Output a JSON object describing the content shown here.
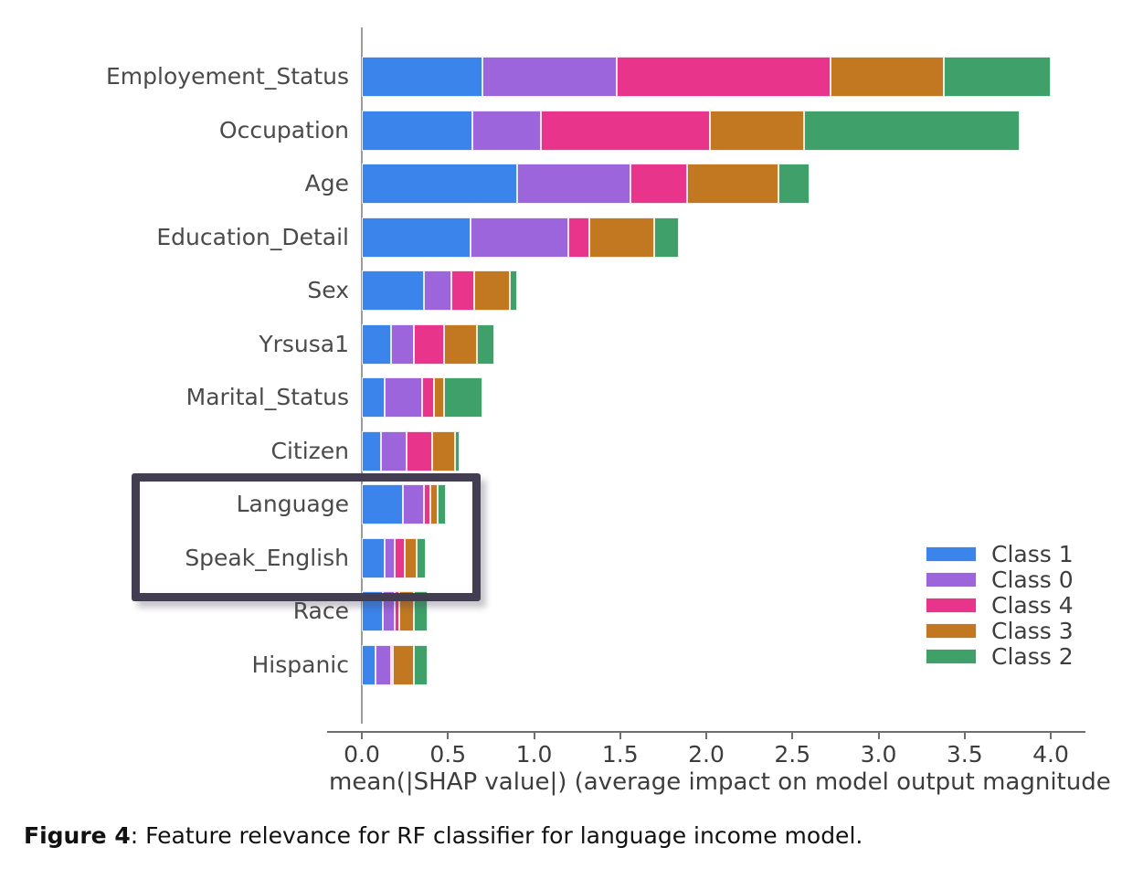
{
  "caption": {
    "label": "Figure 4",
    "text": ": Feature relevance for RF classifier for language income model."
  },
  "chart_data": {
    "type": "bar",
    "orientation": "horizontal",
    "stacked": true,
    "title": "",
    "xlabel": "mean(|SHAP value|) (average impact on model output magnitude",
    "ylabel": "",
    "xlim": [
      0.0,
      4.0
    ],
    "xticks": [
      "0.0",
      "0.5",
      "1.0",
      "1.5",
      "2.0",
      "2.5",
      "3.0",
      "3.5",
      "4.0"
    ],
    "xtick_values": [
      0.0,
      0.5,
      1.0,
      1.5,
      2.0,
      2.5,
      3.0,
      3.5,
      4.0
    ],
    "grid": false,
    "legend_position": "center right",
    "categories": [
      "Employement_Status",
      "Occupation",
      "Age",
      "Education_Detail",
      "Sex",
      "Yrsusa1",
      "Marital_Status",
      "Citizen",
      "Language",
      "Speak_English",
      "Race",
      "Hispanic"
    ],
    "series": [
      {
        "name": "Class 1",
        "color": "#3b84ec",
        "values": [
          0.7,
          0.64,
          0.9,
          0.63,
          0.36,
          0.17,
          0.13,
          0.11,
          0.24,
          0.13,
          0.12,
          0.08
        ]
      },
      {
        "name": "Class 0",
        "color": "#9c65db",
        "values": [
          0.78,
          0.4,
          0.66,
          0.57,
          0.16,
          0.13,
          0.22,
          0.15,
          0.12,
          0.06,
          0.07,
          0.09
        ]
      },
      {
        "name": "Class 4",
        "color": "#e8348b",
        "values": [
          1.24,
          0.98,
          0.33,
          0.12,
          0.13,
          0.18,
          0.07,
          0.15,
          0.04,
          0.06,
          0.03,
          0.01
        ]
      },
      {
        "name": "Class 3",
        "color": "#c17820",
        "values": [
          0.66,
          0.55,
          0.53,
          0.38,
          0.21,
          0.19,
          0.06,
          0.13,
          0.04,
          0.07,
          0.08,
          0.12
        ]
      },
      {
        "name": "Class 2",
        "color": "#3fa06a",
        "values": [
          0.62,
          1.25,
          0.18,
          0.14,
          0.04,
          0.1,
          0.22,
          0.03,
          0.05,
          0.05,
          0.08,
          0.08
        ]
      }
    ],
    "totals": [
      4.0,
      3.82,
      2.6,
      1.84,
      0.9,
      0.77,
      0.7,
      0.57,
      0.49,
      0.37,
      0.38,
      0.38
    ]
  },
  "legend": {
    "items": [
      {
        "label": "Class 1",
        "color": "#3b84ec"
      },
      {
        "label": "Class 0",
        "color": "#9c65db"
      },
      {
        "label": "Class 4",
        "color": "#e8348b"
      },
      {
        "label": "Class 3",
        "color": "#c17820"
      },
      {
        "label": "Class 2",
        "color": "#3fa06a"
      }
    ]
  },
  "highlight": {
    "features": [
      "Language",
      "Speak_English"
    ],
    "color": "#423d50"
  }
}
